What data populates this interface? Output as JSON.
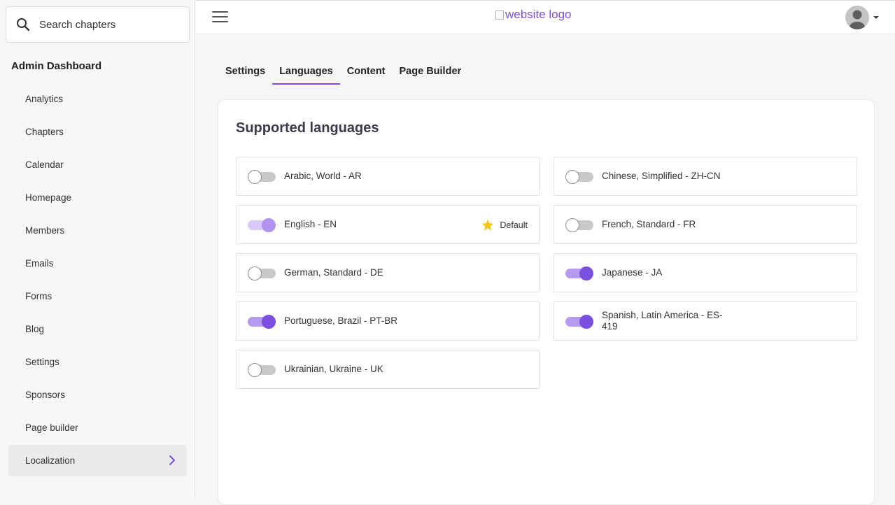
{
  "search": {
    "placeholder": "Search chapters"
  },
  "sidebar": {
    "heading": "Admin Dashboard",
    "items": [
      {
        "label": "Analytics"
      },
      {
        "label": "Chapters"
      },
      {
        "label": "Calendar"
      },
      {
        "label": "Homepage"
      },
      {
        "label": "Members"
      },
      {
        "label": "Emails"
      },
      {
        "label": "Forms"
      },
      {
        "label": "Blog"
      },
      {
        "label": "Settings"
      },
      {
        "label": "Sponsors"
      },
      {
        "label": "Page builder"
      },
      {
        "label": "Localization",
        "active": true
      }
    ]
  },
  "header": {
    "logo_alt": "website logo"
  },
  "tabs": [
    {
      "label": "Settings"
    },
    {
      "label": "Languages",
      "active": true
    },
    {
      "label": "Content"
    },
    {
      "label": "Page Builder"
    }
  ],
  "card": {
    "title": "Supported languages",
    "default_label": "Default",
    "languages": [
      {
        "name": "Arabic, World - AR",
        "enabled": false
      },
      {
        "name": "Chinese, Simplified - ZH-CN",
        "enabled": false
      },
      {
        "name": "English - EN",
        "enabled": true,
        "default": true
      },
      {
        "name": "French, Standard - FR",
        "enabled": false
      },
      {
        "name": "German, Standard - DE",
        "enabled": false
      },
      {
        "name": "Japanese - JA",
        "enabled": true
      },
      {
        "name": "Portuguese, Brazil - PT-BR",
        "enabled": true
      },
      {
        "name": "Spanish, Latin America - ES-419",
        "enabled": true
      },
      {
        "name": "Ukrainian, Ukraine - UK",
        "enabled": false
      }
    ]
  },
  "colors": {
    "accent": "#7b4fe0",
    "star": "#f5c518"
  },
  "icons": {
    "search": "search-icon",
    "menu": "hamburger-icon",
    "chevron": "chevron-right-icon",
    "star": "star-icon",
    "avatar": "user-avatar-icon"
  }
}
